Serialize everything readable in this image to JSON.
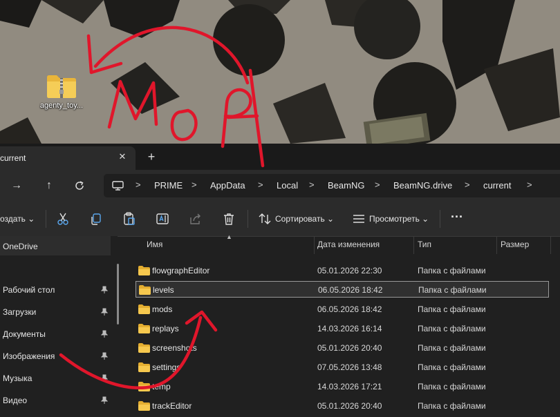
{
  "desktop": {
    "icon_label": "agenty_toy..."
  },
  "explorer": {
    "tab": {
      "title": "current"
    },
    "address": {
      "crumbs": [
        "PRIME",
        "AppData",
        "Local",
        "BeamNG",
        "BeamNG.drive",
        "current"
      ]
    },
    "toolbar": {
      "create_label": "оздать",
      "sort_label": "Сортировать",
      "view_label": "Просмотреть"
    },
    "sidebar": {
      "onedrive": "OneDrive",
      "items": [
        "Рабочий стол",
        "Загрузки",
        "Документы",
        "Изображения",
        "Музыка",
        "Видео"
      ]
    },
    "columns": {
      "name": "Имя",
      "date": "Дата изменения",
      "type": "Тип",
      "size": "Размер"
    },
    "rows": [
      {
        "name": "flowgraphEditor",
        "date": "05.01.2026 22:30",
        "type": "Папка с файлами"
      },
      {
        "name": "levels",
        "date": "06.05.2026 18:42",
        "type": "Папка с файлами"
      },
      {
        "name": "mods",
        "date": "06.05.2026 18:42",
        "type": "Папка с файлами"
      },
      {
        "name": "replays",
        "date": "14.03.2026 16:14",
        "type": "Папка с файлами"
      },
      {
        "name": "screenshots",
        "date": "05.01.2026 20:40",
        "type": "Папка с файлами"
      },
      {
        "name": "settings",
        "date": "07.05.2026 13:48",
        "type": "Папка с файлами"
      },
      {
        "name": "temp",
        "date": "14.03.2026 17:21",
        "type": "Папка с файлами"
      },
      {
        "name": "trackEditor",
        "date": "05.01.2026 20:40",
        "type": "Папка с файлами"
      }
    ]
  },
  "annotation": {
    "handwritten_text": "МОЯ",
    "color": "#e0162b"
  }
}
